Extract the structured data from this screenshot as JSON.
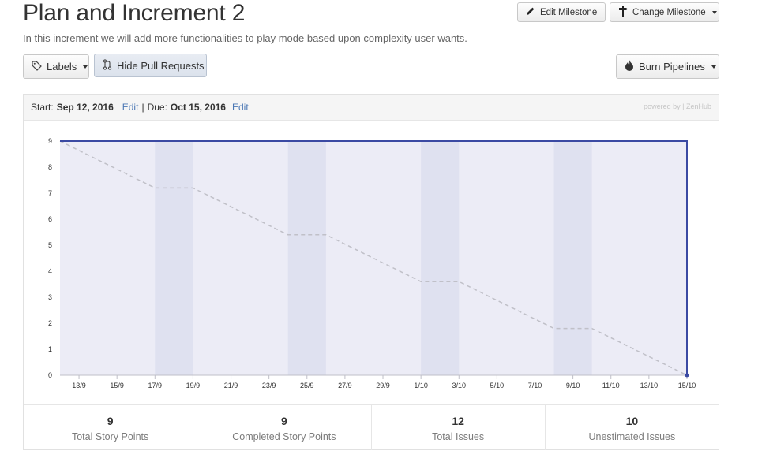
{
  "milestone": {
    "title": "Plan and Increment 2",
    "description": "In this increment we will add more functionalities to play mode based upon complexity user wants."
  },
  "toolbar": {
    "edit_milestone": "Edit Milestone",
    "change_milestone": "Change Milestone",
    "labels": "Labels",
    "hide_pull_requests": "Hide Pull Requests",
    "burn_pipelines": "Burn Pipelines"
  },
  "panel": {
    "start_label": "Start:",
    "start_date": "Sep 12, 2016",
    "edit1": "Edit",
    "separator": "|",
    "due_label": "Due:",
    "due_date": "Oct 15, 2016",
    "edit2": "Edit",
    "powered_by": "powered by | ZenHub"
  },
  "chart_data": {
    "type": "line",
    "title": "",
    "xlabel": "",
    "ylabel": "",
    "ylim": [
      0,
      9
    ],
    "y_ticks": [
      "0",
      "1",
      "2",
      "3",
      "4",
      "5",
      "6",
      "7",
      "8",
      "9"
    ],
    "x_ticks": [
      "13/9",
      "15/9",
      "17/9",
      "19/9",
      "21/9",
      "23/9",
      "25/9",
      "27/9",
      "29/9",
      "1/10",
      "3/10",
      "5/10",
      "7/10",
      "9/10",
      "11/10",
      "13/10",
      "15/10"
    ],
    "x_range_days": [
      "12/9",
      "15/10"
    ],
    "weekends": [
      [
        "17/9",
        "19/9"
      ],
      [
        "24/9",
        "26/9"
      ],
      [
        "1/10",
        "3/10"
      ],
      [
        "8/10",
        "10/10"
      ]
    ],
    "series": [
      {
        "style": "ideal",
        "color": "#c0c0c8",
        "points": [
          [
            "12/9",
            9
          ],
          [
            "17/9",
            7.2
          ],
          [
            "19/9",
            7.2
          ],
          [
            "24/9",
            5.4
          ],
          [
            "26/9",
            5.4
          ],
          [
            "1/10",
            3.6
          ],
          [
            "3/10",
            3.6
          ],
          [
            "8/10",
            1.8
          ],
          [
            "10/10",
            1.8
          ],
          [
            "15/10",
            0
          ]
        ]
      },
      {
        "style": "actual",
        "color": "#3b4aa3",
        "points": [
          [
            "12/9",
            9
          ],
          [
            "15/10",
            9
          ],
          [
            "15/10",
            0
          ]
        ]
      }
    ],
    "colors": {
      "plot_bg": "#ececf6",
      "weekend_bg": "#dfe1f0"
    }
  },
  "stats": [
    {
      "value": "9",
      "label": "Total Story Points"
    },
    {
      "value": "9",
      "label": "Completed Story Points"
    },
    {
      "value": "12",
      "label": "Total Issues"
    },
    {
      "value": "10",
      "label": "Unestimated Issues"
    }
  ]
}
